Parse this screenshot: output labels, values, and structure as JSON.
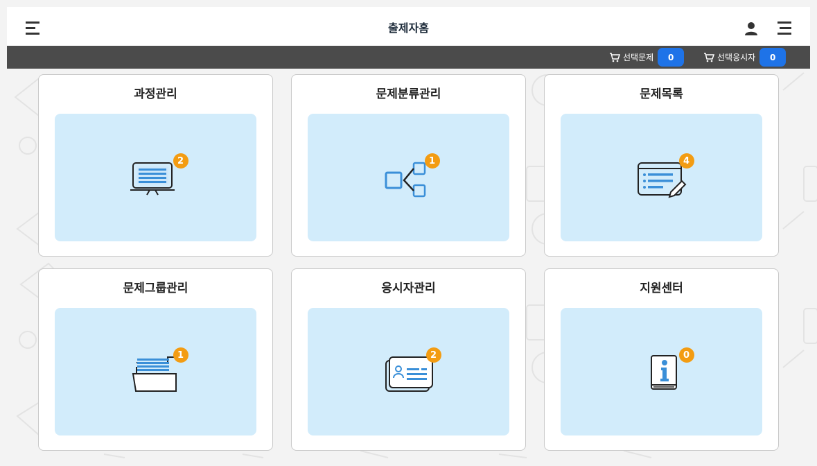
{
  "header": {
    "title": "출제자홈",
    "menu_left_icon": "hamburger-icon",
    "user_icon": "user-icon",
    "menu_right_icon": "hamburger-icon"
  },
  "subbar": {
    "selected_questions_label": "선택문제",
    "selected_questions_count": "0",
    "selected_examinees_label": "선택응시자",
    "selected_examinees_count": "0",
    "cart_icon": "cart-icon"
  },
  "cards": [
    {
      "title": "과정관리",
      "badge": "2",
      "icon": "presentation-board-icon"
    },
    {
      "title": "문제분류관리",
      "badge": "1",
      "icon": "hierarchy-icon"
    },
    {
      "title": "문제목록",
      "badge": "4",
      "icon": "list-edit-icon"
    },
    {
      "title": "문제그룹관리",
      "badge": "1",
      "icon": "open-folder-icon"
    },
    {
      "title": "응시자관리",
      "badge": "2",
      "icon": "id-card-icon"
    },
    {
      "title": "지원센터",
      "badge": "0",
      "icon": "info-book-icon"
    }
  ],
  "colors": {
    "header_bg": "#ffffff",
    "subbar_bg": "#4b4b4b",
    "count_badge": "#1e73e8",
    "panel_bg": "#d2ecfb",
    "notification_badge": "#f39c12",
    "icon_blue": "#3a8fd8"
  }
}
